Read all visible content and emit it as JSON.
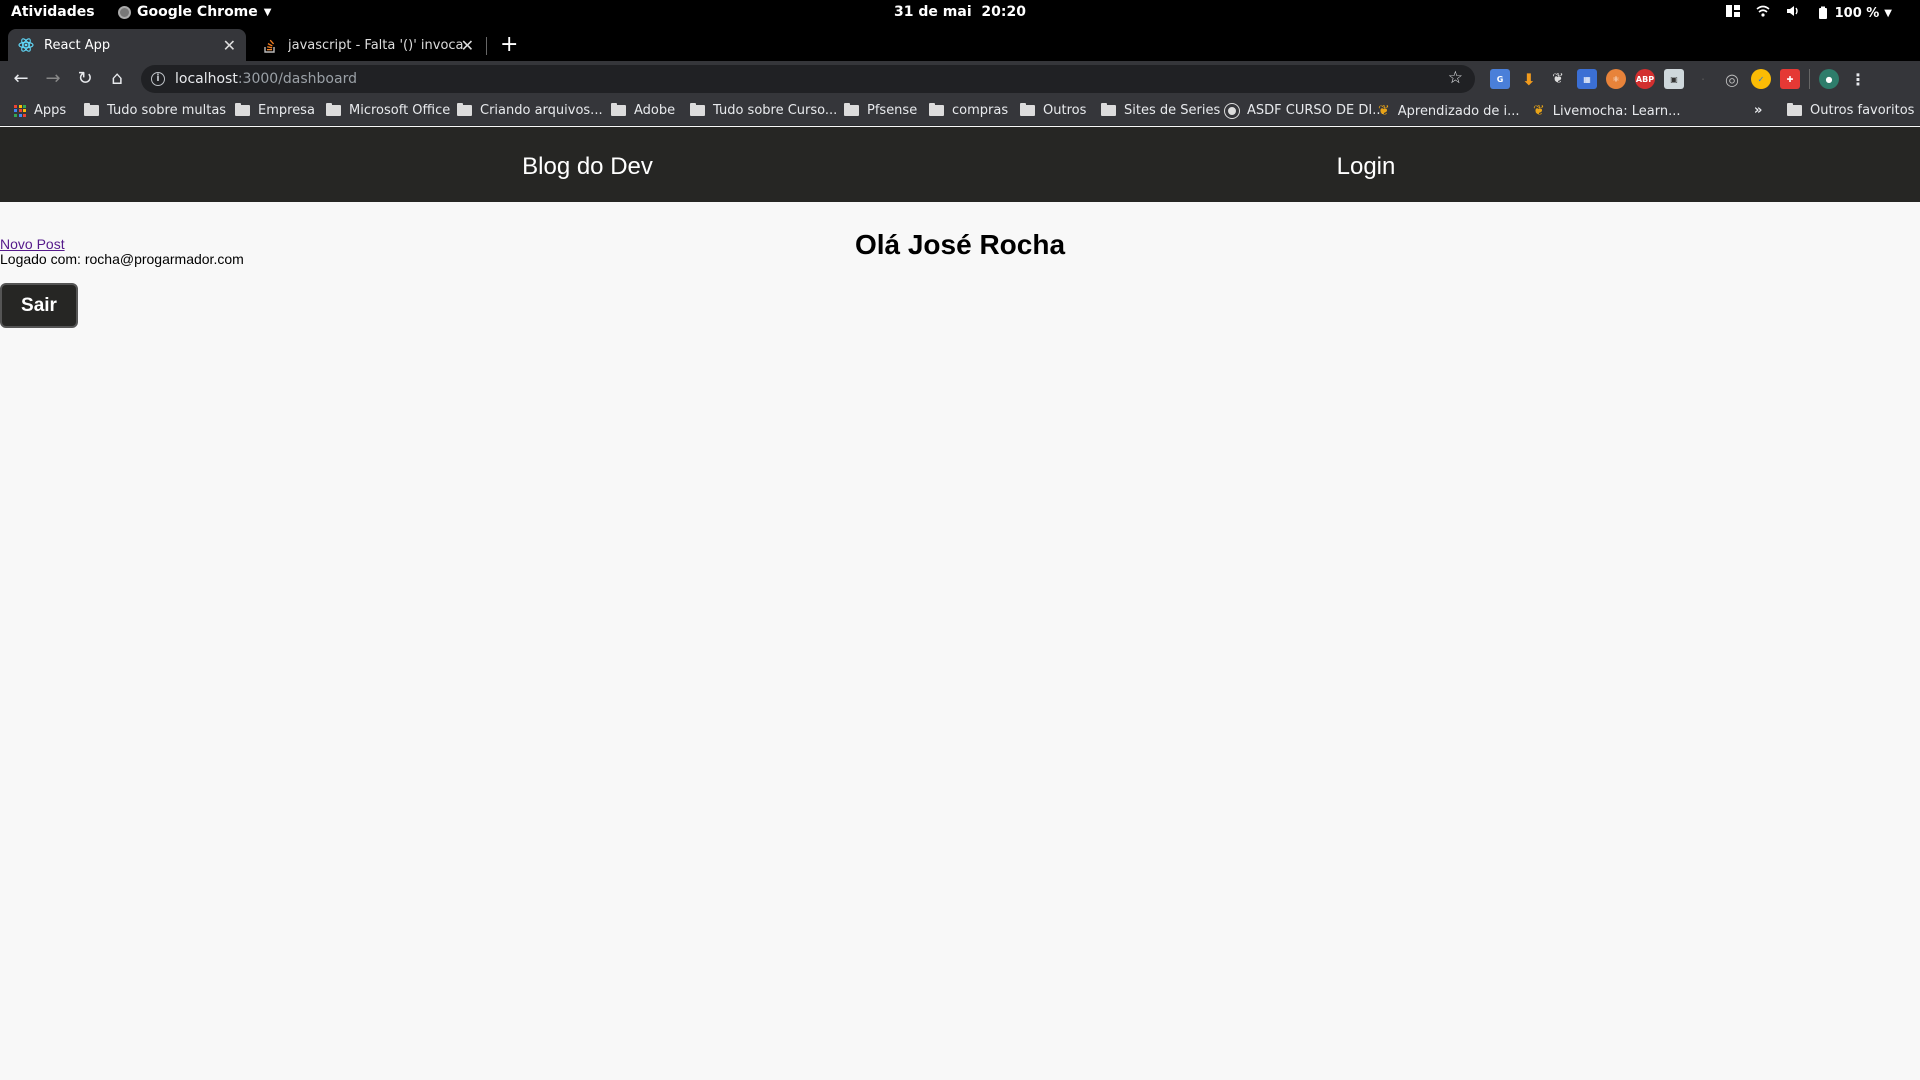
{
  "system_bar": {
    "activities": "Atividades",
    "app_name": "Google Chrome",
    "date": "31 de mai",
    "time": "20:20",
    "battery": "100 %"
  },
  "browser": {
    "tabs": [
      {
        "title": "React App",
        "active": true
      },
      {
        "title": "javascript - Falta '()' invocand",
        "active": false
      }
    ],
    "url": {
      "host": "localhost",
      "rest": ":3000/dashboard"
    },
    "bookmarks": {
      "apps": "Apps",
      "items": [
        "Tudo sobre multas",
        "Empresa",
        "Microsoft Office",
        "Criando arquivos...",
        "Adobe",
        "Tudo sobre Curso...",
        "Pfsense",
        "compras",
        "Outros",
        "Sites de Series",
        "ASDF CURSO DE DI...",
        "Aprendizado de i...",
        "Livemocha: Learn..."
      ],
      "overflow": "»",
      "other": "Outros favoritos"
    }
  },
  "site": {
    "brand": "Blog do Dev",
    "login": "Login"
  },
  "dashboard": {
    "new_post_link": "Novo Post",
    "logged_label": "Logado com: rocha@progarmador.com",
    "greeting": "Olá José Rocha",
    "logout_button": "Sair"
  }
}
